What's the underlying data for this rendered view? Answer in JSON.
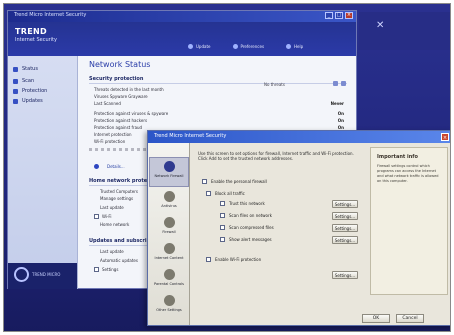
{
  "window": {
    "title": "Trend Micro Internet Security",
    "brand_top": "TREND",
    "brand_sub": "Internet Security",
    "nav": [
      "Update",
      "Preferences",
      "Help"
    ]
  },
  "sidebar": {
    "items": [
      "Status",
      "Scan",
      "Protection",
      "Updates"
    ],
    "footer": "TREND MICRO"
  },
  "content": {
    "page_title": "Network Status",
    "section_security": "Security protection",
    "status_right": "No threats",
    "rows": [
      {
        "label": "Threats detected in the last month",
        "value": "0"
      },
      {
        "label": "Viruses   Spyware   Grayware",
        "value": "0"
      },
      {
        "label": "Last Scanned",
        "value": "Never"
      },
      {
        "label": "Protection against viruses & spyware",
        "value": "On"
      },
      {
        "label": "Protection against hackers",
        "value": "On"
      },
      {
        "label": "Protection against fraud",
        "value": "On"
      },
      {
        "label": "Internet protection",
        "value": "On"
      },
      {
        "label": "Wi-Fi protection",
        "value": "On"
      }
    ],
    "details_link": "Details...",
    "section_network": "Home network protection",
    "network_rows": [
      "Trusted Computers",
      "Manage settings",
      "Last update",
      "Wi-Fi",
      "Home network"
    ],
    "section_updates": "Updates and subscription",
    "update_rows": [
      "Last update",
      "Automatic updates",
      "Settings"
    ]
  },
  "dialog": {
    "title": "Trend Micro Internet Security",
    "categories": [
      "Network Firewall",
      "Antivirus",
      "Firewall",
      "Internet Content",
      "Parental Controls",
      "Other Settings"
    ],
    "description": "Use this screen to set options for firewall, Internet traffic and Wi-Fi protection. Click Add to set the trusted network addresses.",
    "checks": [
      "Enable the personal firewall",
      "Block all traffic",
      "Trust this network",
      "Scan files on network",
      "Scan compressed files",
      "Show alert messages",
      "Enable Wi-Fi protection"
    ],
    "buttons": [
      "Settings...",
      "Settings...",
      "Settings...",
      "Settings...",
      "Settings..."
    ],
    "help_title": "Important info",
    "help_text": "Firewall settings control which programs can access the Internet and what network traffic is allowed on this computer.",
    "ok": "OK",
    "cancel": "Cancel"
  }
}
